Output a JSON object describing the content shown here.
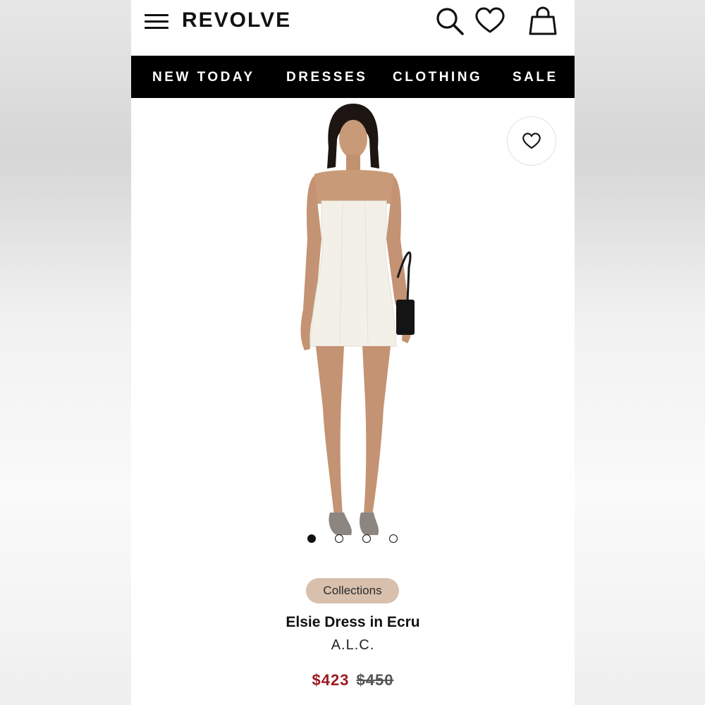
{
  "header": {
    "logo": "REVOLVE",
    "icons": [
      "menu-icon",
      "search-icon",
      "heart-icon",
      "bag-icon"
    ]
  },
  "nav": {
    "items": [
      {
        "label": "NEW TODAY"
      },
      {
        "label": "DRESSES"
      },
      {
        "label": "CLOTHING"
      },
      {
        "label": "SALE"
      }
    ]
  },
  "product": {
    "collection_badge": "Collections",
    "name": "Elsie Dress in Ecru",
    "brand": "A.L.C.",
    "price_sale": "$423",
    "price_original": "$450",
    "image_count": 4,
    "active_image_index": 0
  },
  "colors": {
    "nav_background": "#000000",
    "sale_price": "#9b1b22",
    "badge_background": "#d8c0ad"
  }
}
